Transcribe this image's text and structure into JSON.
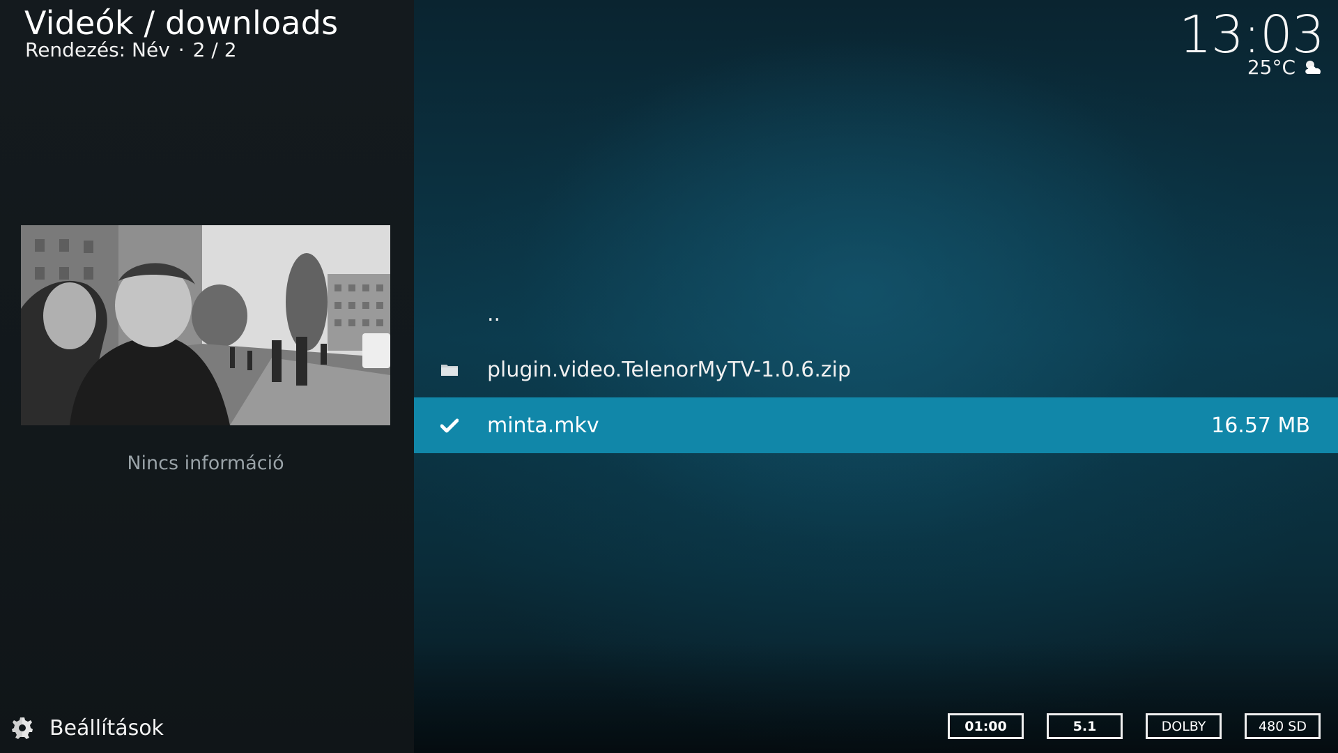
{
  "header": {
    "title": "Videók / downloads",
    "sort_label": "Rendezés: Név",
    "separator": "·",
    "position": "2 / 2"
  },
  "clock": {
    "time": "13:03",
    "temperature": "25°C",
    "weather_icon": "partly-cloudy-icon"
  },
  "info_panel": {
    "thumbnail_icon": "video-thumbnail",
    "no_info_text": "Nincs információ"
  },
  "settings": {
    "label": "Beállítások",
    "icon": "settings-icon"
  },
  "file_list": [
    {
      "name": "..",
      "icon": "",
      "size": "",
      "selected": false
    },
    {
      "name": "plugin.video.TelenorMyTV-1.0.6.zip",
      "icon": "folder-icon",
      "size": "",
      "selected": false
    },
    {
      "name": "minta.mkv",
      "icon": "checkmark-icon",
      "size": "16.57 MB",
      "selected": true
    }
  ],
  "media_badges": [
    "01:00",
    "5.1",
    "DOLBY",
    "480 SD"
  ],
  "colors": {
    "accent": "#1187a9",
    "left_panel": "#141a1e",
    "background": "#0c3a4c"
  }
}
